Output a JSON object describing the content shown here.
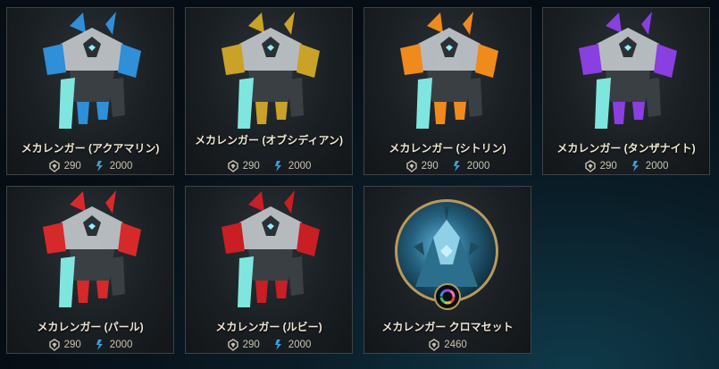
{
  "colors": {
    "aqua": "#2f8fd8",
    "obsidian": "#c9a227",
    "citrine": "#f08a1c",
    "tanzanite": "#8a3fe0",
    "pearl": "#d62a2a",
    "ruby": "#c81e24",
    "rp_icon": "#c9c2b0",
    "essence_icon": "#3aa0e0"
  },
  "cards": [
    {
      "title": "メカレンガー (アクアマリン)",
      "rp": "290",
      "essence": "2000",
      "icon": "mecha-robot-aquamarine"
    },
    {
      "title": "メカレンガー (オブシディアン)",
      "rp": "290",
      "essence": "2000",
      "icon": "mecha-robot-obsidian"
    },
    {
      "title": "メカレンガー (シトリン)",
      "rp": "290",
      "essence": "2000",
      "icon": "mecha-robot-citrine"
    },
    {
      "title": "メカレンガー (タンザナイト)",
      "rp": "290",
      "essence": "2000",
      "icon": "mecha-robot-tanzanite"
    },
    {
      "title": "メカレンガー (パール)",
      "rp": "290",
      "essence": "2000",
      "icon": "mecha-robot-pearl"
    },
    {
      "title": "メカレンガー (ルビー)",
      "rp": "290",
      "essence": "2000",
      "icon": "mecha-robot-ruby"
    }
  ],
  "bundle": {
    "title": "メカレンガー クロマセット",
    "rp": "2460",
    "icon": "chroma-wheel-icon"
  }
}
